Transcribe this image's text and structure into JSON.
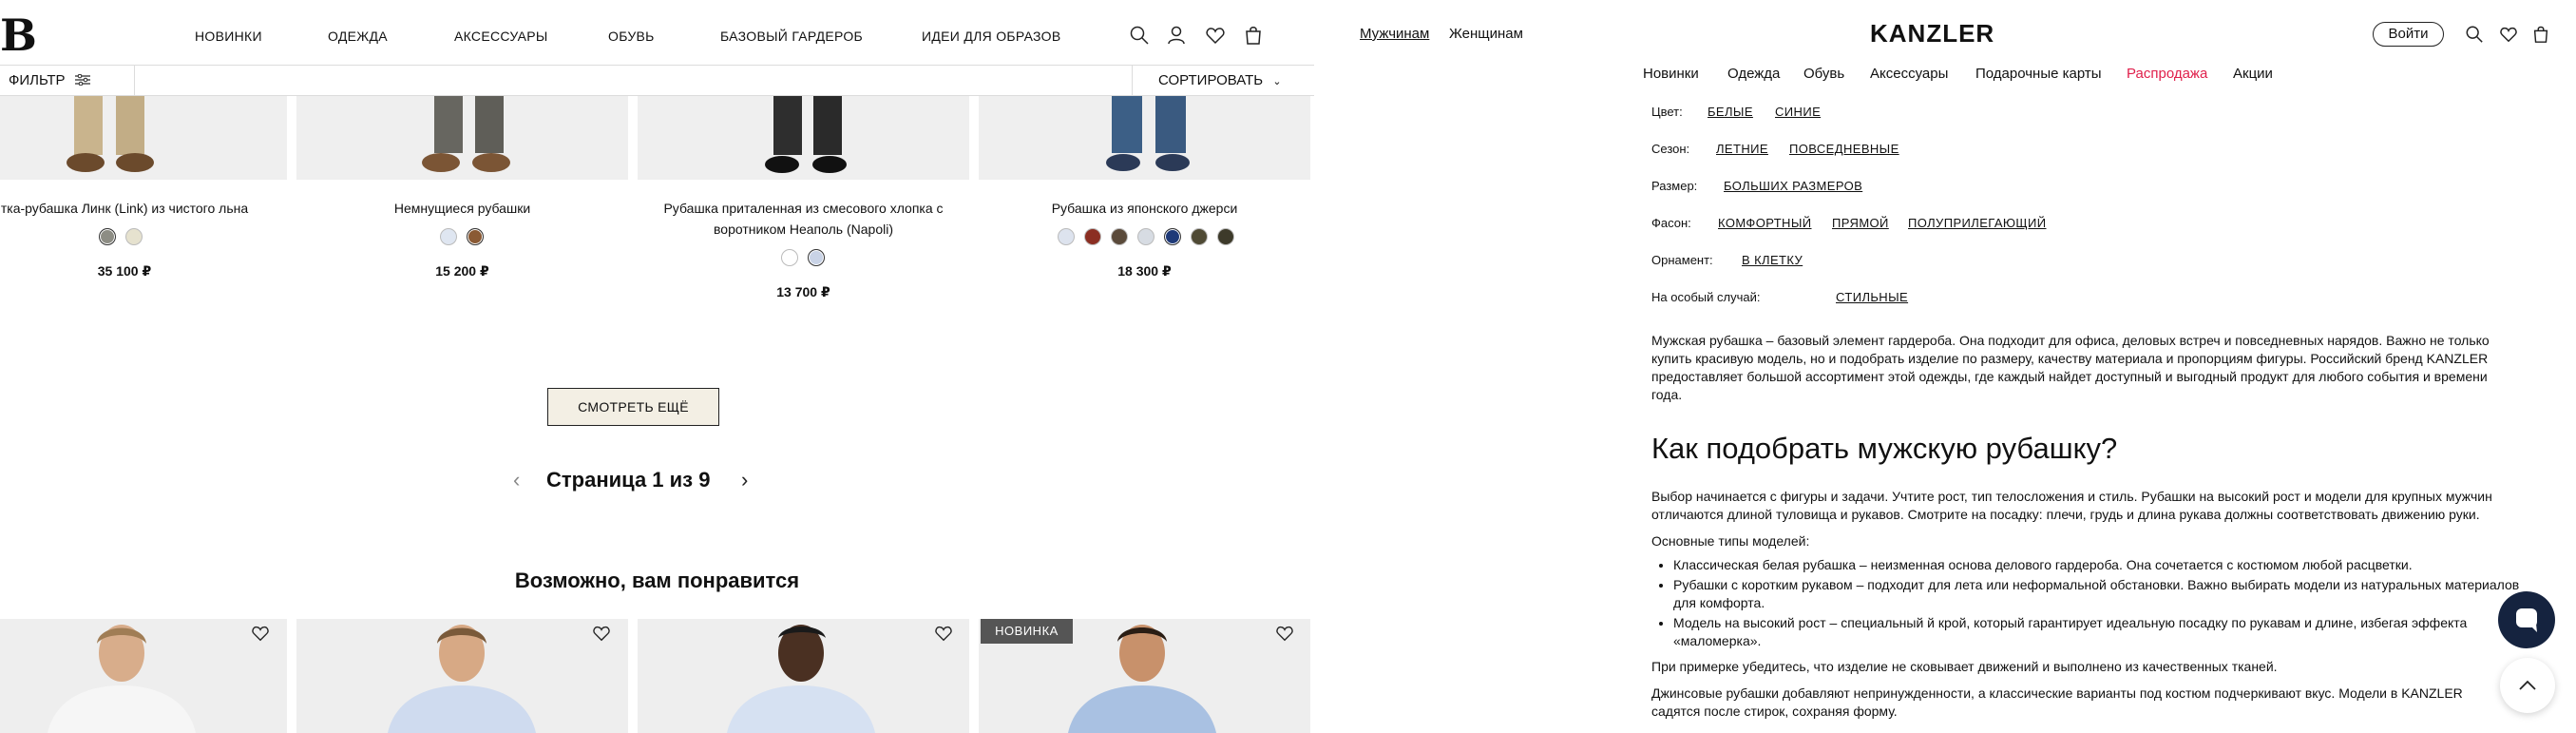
{
  "left": {
    "logo": "B",
    "nav": [
      "НОВИНКИ",
      "ОДЕЖДА",
      "АКСЕССУАРЫ",
      "ОБУВЬ",
      "БАЗОВЫЙ ГАРДЕРОБ",
      "ИДЕИ ДЛЯ ОБРАЗОВ"
    ],
    "filter_label": "ФИЛЬТР",
    "sort_label": "СОРТИРОВАТЬ",
    "products": [
      {
        "title_lines": [
          "тка-рубашка Линк (Link) из чистого льна"
        ],
        "price": "35 100 ₽",
        "swatches": [
          "#8d8d84",
          "#e6e2cf"
        ]
      },
      {
        "title_lines": [
          "Немнущиеся рубашки"
        ],
        "price": "15 200 ₽",
        "swatches": [
          "#dfe6f1",
          "#8a5a34"
        ]
      },
      {
        "title_lines": [
          "Рубашка приталенная из смесового хлопка с",
          "воротником Неаполь (Napoli)"
        ],
        "price": "13 700 ₽",
        "swatches": [
          "#ffffff",
          "#c9d3e6"
        ]
      },
      {
        "title_lines": [
          "Рубашка из японского джерси"
        ],
        "price": "18 300 ₽",
        "swatches": [
          "#dde3ee",
          "#8b2e22",
          "#5a4a3a",
          "#d7dce3",
          "#1f3a78",
          "#4f4a34",
          "#3d3a2a"
        ]
      }
    ],
    "more_button": "СМОТРЕТЬ ЕЩЁ",
    "pagination": "Страница 1 из 9",
    "recommend_title": "Возможно, вам понравится",
    "badge_new": "НОВИНКА"
  },
  "right": {
    "gender_tabs": [
      "Мужчинам",
      "Женщинам"
    ],
    "logo": "KANZLER",
    "login_label": "Войти",
    "categories": [
      "Новинки",
      "Одежда",
      "Обувь",
      "Аксессуары",
      "Подарочные карты",
      "Распродажа",
      "Акции"
    ],
    "tags": [
      {
        "label": "Цвет:",
        "links": [
          "БЕЛЫЕ",
          "СИНИЕ"
        ]
      },
      {
        "label": "Сезон:",
        "links": [
          "ЛЕТНИЕ",
          "ПОВСЕДНЕВНЫЕ"
        ]
      },
      {
        "label": "Размер:",
        "links": [
          "БОЛЬШИХ РАЗМЕРОВ"
        ]
      },
      {
        "label": "Фасон:",
        "links": [
          "КОМФОРТНЫЙ",
          "ПРЯМОЙ",
          "ПОЛУПРИЛЕГАЮЩИЙ"
        ]
      },
      {
        "label": "Орнамент:",
        "links": [
          "В КЛЕТКУ"
        ]
      },
      {
        "label": "На особый случай:",
        "links": [
          "СТИЛЬНЫЕ"
        ]
      }
    ],
    "intro_lines": [
      "Мужская рубашка – базовый элемент гардероба. Она подходит для офиса, деловых встреч и повседневных нарядов. Важно не только",
      "купить красивую модель, но и подобрать изделие по размеру, качеству материала и пропорциям фигуры. Российский бренд KANZLER",
      "предоставляет большой ассортимент этой одежды, где каждый найдет доступный и выгодный продукт для любого события и времени",
      "года."
    ],
    "heading": "Как подобрать мужскую рубашку?",
    "para1_lines": [
      "Выбор начинается с фигуры и задачи. Учтите рост, тип телосложения и стиль. Рубашки на высокий рост и модели для крупных мужчин",
      "отличаются длиной туловища и рукавов. Смотрите на посадку: плечи, грудь и длина рукава должны соответствовать движению руки."
    ],
    "types_label": "Основные типы моделей:",
    "bullets": [
      "Классическая белая рубашка – неизменная основа делового гардероба. Она сочетается с костюмом любой расцветки.",
      "Рубашки с коротким рукавом – подходит для лета или неформальной обстановки. Важно выбирать модели из натуральных материалов для комфорта.",
      "Модель на высокий рост – специальный й крой, который гарантирует идеальную посадку по рукавам и длине, избегая эффекта «маломерка»."
    ],
    "fitting_line": "При примерке убедитесь, что изделие не сковывает движений и выполнено из качественных тканей.",
    "denim_lines": [
      "Джинсовые рубашки добавляют непринужденности, а классические варианты под костюм подчеркивают вкус. Модели в KANZLER",
      "садятся после стирок, сохраняя форму."
    ]
  }
}
